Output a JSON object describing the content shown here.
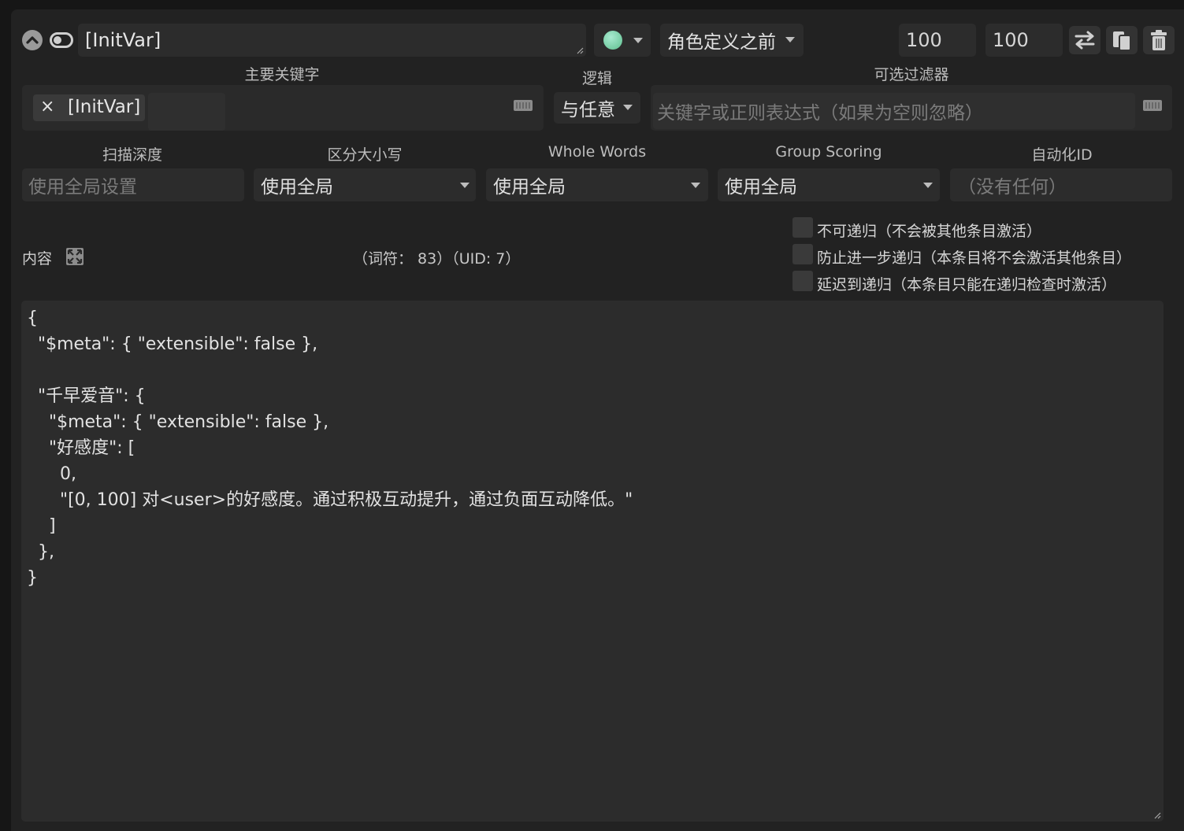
{
  "header": {
    "title_value": "[InitVar]",
    "position_select": "角色定义之前",
    "order_value": "100",
    "probability_value": "100"
  },
  "labels": {
    "primary_keywords": "主要关键字",
    "logic": "逻辑",
    "optional_filter": "可选过滤器",
    "scan_depth": "扫描深度",
    "case_sensitive": "区分大小写",
    "whole_words": "Whole Words",
    "group_scoring": "Group Scoring",
    "automation_id": "自动化ID",
    "content": "内容"
  },
  "keywords": {
    "tag_label": "[InitVar]",
    "tag_remove": "×"
  },
  "logic_select": "与任意",
  "filter": {
    "placeholder": "关键字或正则表达式（如果为空则忽略）"
  },
  "settings": {
    "scan_depth_placeholder": "使用全局设置",
    "case_sensitive_value": "使用全局",
    "whole_words_value": "使用全局",
    "group_scoring_value": "使用全局",
    "automation_id_placeholder": "（没有任何）"
  },
  "stats": {
    "text": "（词符： 83）（UID: 7）"
  },
  "checkboxes": [
    {
      "label": "不可递归（不会被其他条目激活）"
    },
    {
      "label": "防止进一步递归（本条目将不会激活其他条目）"
    },
    {
      "label": "延迟到递归（本条目只能在递归检查时激活）"
    }
  ],
  "content_text": "{\n  \"$meta\": { \"extensible\": false },\n\n  \"千早爱音\": {\n    \"$meta\": { \"extensible\": false },\n    \"好感度\": [\n      0,\n      \"[0, 100] 对<user>的好感度。通过积极互动提升，通过负面互动降低。\"\n    ]\n  },\n}",
  "colors": {
    "background": "#161616",
    "panel": "#222222",
    "field": "#2c2c2c",
    "status_dot": "#7ecfa3"
  },
  "icons": [
    "chevron-up-icon",
    "toggle-icon",
    "status-dot-icon",
    "swap-icon",
    "copy-icon",
    "trash-icon",
    "keyboard-icon",
    "expand-icon",
    "resize-handle-icon"
  ]
}
